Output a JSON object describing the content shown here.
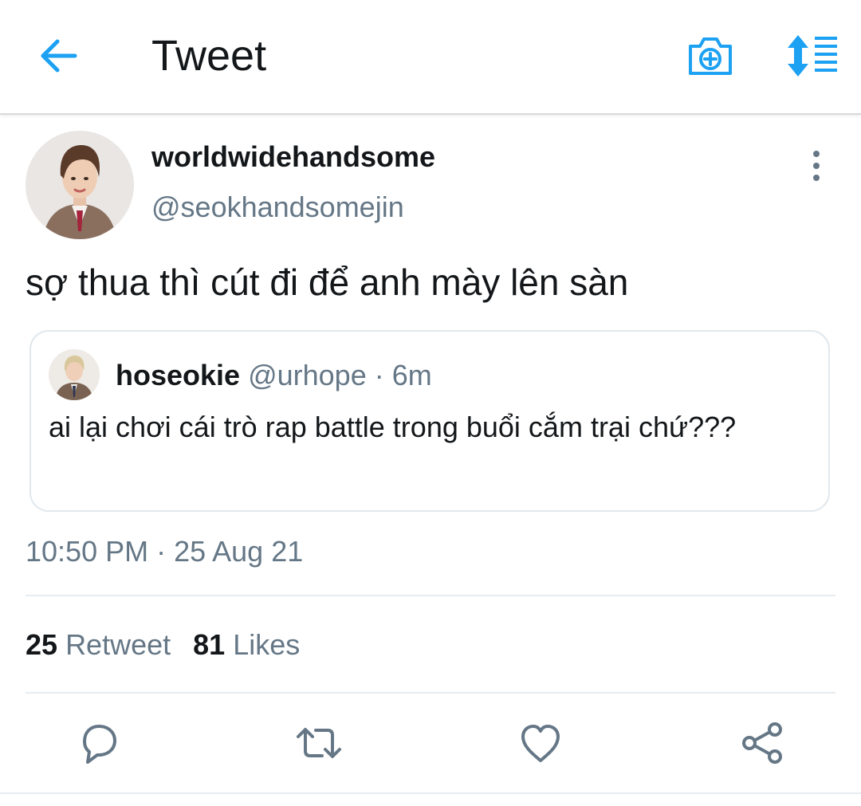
{
  "header": {
    "title": "Tweet",
    "back_icon": "arrow-left-icon",
    "camera_icon": "camera-plus-icon",
    "sort_icon": "sort-list-icon",
    "accent_color": "#1da1f2"
  },
  "tweet": {
    "author": {
      "display_name": "worldwidehandsome",
      "handle": "@seokhandsomejin"
    },
    "text": "sợ thua thì cút đi để anh mày lên sàn",
    "quoted": {
      "display_name": "hoseokie",
      "handle": "@urhope",
      "separator": "·",
      "time": "6m",
      "text": "ai lại chơi cái trò rap battle trong buổi cắm trại chứ???"
    },
    "time": "10:50 PM",
    "separator": "·",
    "date": "25 Aug 21",
    "stats": {
      "retweets_count": "25",
      "retweets_label": "Retweet",
      "likes_count": "81",
      "likes_label": "Likes"
    }
  },
  "actions": [
    "reply-icon",
    "retweet-icon",
    "like-icon",
    "share-icon"
  ],
  "colors": {
    "text_primary": "#14171a",
    "text_secondary": "#657786",
    "border": "#e1e8ed"
  }
}
